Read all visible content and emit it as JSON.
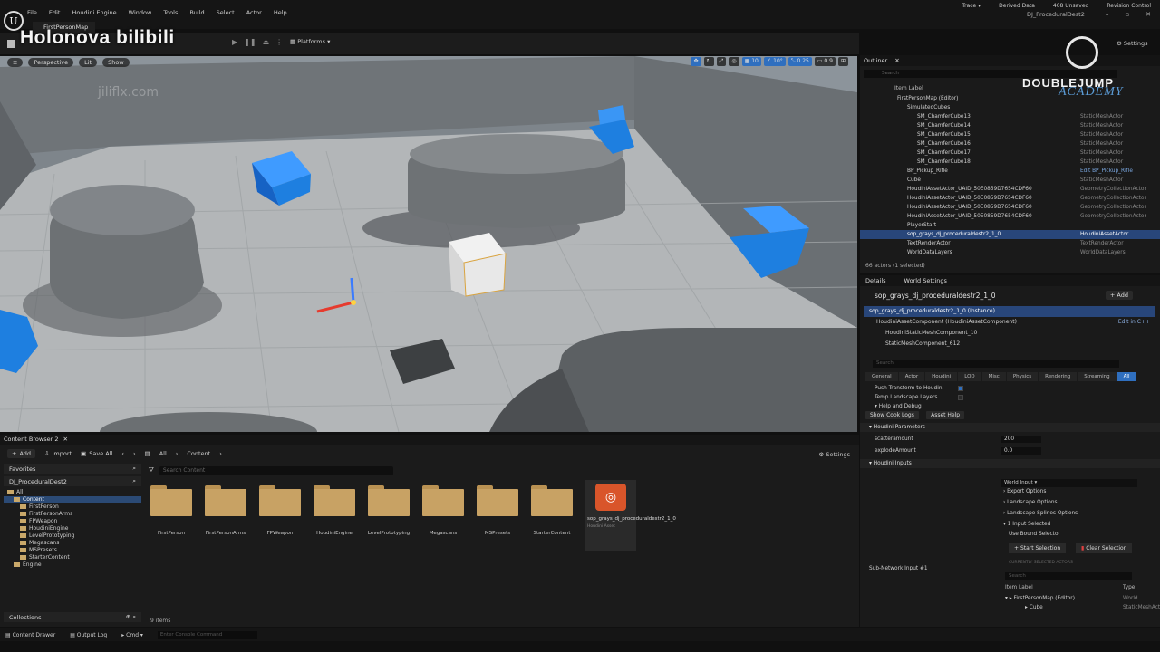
{
  "window": {
    "title": "DJ_ProceduralDest2",
    "menu": [
      "File",
      "Edit",
      "Houdini Engine",
      "Window",
      "Tools",
      "Build",
      "Select",
      "Actor",
      "Help"
    ],
    "map_tab": "FirstPersonMap",
    "controls": [
      "–",
      "▫",
      "✕"
    ]
  },
  "overlays": {
    "watermark": "Holonova bilibili",
    "viewport_watermark": "jiliflx.com",
    "brand_title": "DOUBLEJUMP",
    "brand_subtitle": "ACADEMY"
  },
  "toolbar": {
    "platforms": "Platforms"
  },
  "viewport": {
    "perspective": "Perspective",
    "lit": "Lit",
    "show": "Show",
    "snap_translate": "10",
    "snap_rotate": "10°",
    "snap_scale": "0.25",
    "camera_speed": "0.9"
  },
  "content_browser": {
    "tab": "Content Browser 2",
    "add": "Add",
    "import": "Import",
    "save_all": "Save All",
    "path": [
      "All",
      "Content"
    ],
    "settings": "Settings",
    "favorites": "Favorites",
    "project": "DJ_ProceduralDest2",
    "tree": [
      {
        "label": "All",
        "indent": 0
      },
      {
        "label": "Content",
        "indent": 1,
        "selected": true
      },
      {
        "label": "FirstPerson",
        "indent": 2
      },
      {
        "label": "FirstPersonArms",
        "indent": 2
      },
      {
        "label": "FPWeapon",
        "indent": 2
      },
      {
        "label": "HoudiniEngine",
        "indent": 2
      },
      {
        "label": "LevelPrototyping",
        "indent": 2
      },
      {
        "label": "Megascans",
        "indent": 2
      },
      {
        "label": "MSPresets",
        "indent": 2
      },
      {
        "label": "StarterContent",
        "indent": 2
      },
      {
        "label": "Engine",
        "indent": 1
      }
    ],
    "search_placeholder": "Search Content",
    "folders": [
      "FirstPerson",
      "FirstPersonArms",
      "FPWeapon",
      "HoudiniEngine",
      "LevelPrototyping",
      "Megascans",
      "MSPresets",
      "StarterContent"
    ],
    "hda_asset": {
      "label": "sop_grays_dj_proceduraldestr2_1_0",
      "type": "Houdini Asset"
    },
    "collections": "Collections",
    "item_count": "9 items"
  },
  "statusbar": {
    "content_drawer": "Content Drawer",
    "output_log": "Output Log",
    "cmd": "Cmd",
    "console_placeholder": "Enter Console Command",
    "trace": "Trace",
    "derived_data": "Derived Data",
    "unsaved": "408 Unsaved",
    "revision": "Revision Control"
  },
  "outliner": {
    "tab": "Outliner",
    "settings": "Settings",
    "search_placeholder": "Search",
    "col_label": "Item Label",
    "col_type": "Type",
    "rows": [
      {
        "label": "FirstPersonMap (Editor)",
        "type": "",
        "indent": 3
      },
      {
        "label": "SimulatedCubes",
        "type": "",
        "indent": 4
      },
      {
        "label": "SM_ChamferCube13",
        "type": "StaticMeshActor",
        "indent": 5
      },
      {
        "label": "SM_ChamferCube14",
        "type": "StaticMeshActor",
        "indent": 5
      },
      {
        "label": "SM_ChamferCube15",
        "type": "StaticMeshActor",
        "indent": 5
      },
      {
        "label": "SM_ChamferCube16",
        "type": "StaticMeshActor",
        "indent": 5
      },
      {
        "label": "SM_ChamferCube17",
        "type": "StaticMeshActor",
        "indent": 5
      },
      {
        "label": "SM_ChamferCube18",
        "type": "StaticMeshActor",
        "indent": 5
      },
      {
        "label": "BP_Pickup_Rifle",
        "type": "Edit BP_Pickup_Rifle",
        "indent": 4,
        "link": true
      },
      {
        "label": "Cube",
        "type": "StaticMeshActor",
        "indent": 4
      },
      {
        "label": "HoudiniAssetActor_UAID_50E0859D7654CDF601_2083879015",
        "type": "GeometryCollectionActor",
        "indent": 4
      },
      {
        "label": "HoudiniAssetActor_UAID_50E0859D7654CDF601_2083879015",
        "type": "GeometryCollectionActor",
        "indent": 4
      },
      {
        "label": "HoudiniAssetActor_UAID_50E0859D7654CDF601_2083879015",
        "type": "GeometryCollectionActor",
        "indent": 4
      },
      {
        "label": "HoudiniAssetActor_UAID_50E0859D7654CDF601_2083879015",
        "type": "GeometryCollectionActor",
        "indent": 4
      },
      {
        "label": "PlayerStart",
        "type": "",
        "indent": 4
      },
      {
        "label": "sop_grays_dj_proceduraldestr2_1_0",
        "type": "HoudiniAssetActor",
        "indent": 4,
        "selected": true
      },
      {
        "label": "TextRenderActor",
        "type": "TextRenderActor",
        "indent": 4
      },
      {
        "label": "WorldDataLayers",
        "type": "WorldDataLayers",
        "indent": 4
      }
    ],
    "actor_count": "66 actors (1 selected)"
  },
  "details": {
    "tab": "Details",
    "world_settings": "World Settings",
    "actor_name": "sop_grays_dj_proceduraldestr2_1_0",
    "add": "Add",
    "components": [
      {
        "label": "sop_grays_dj_proceduraldestr2_1_0 (Instance)",
        "selected": true,
        "right": ""
      },
      {
        "label": "HoudiniAssetComponent (HoudiniAssetComponent)",
        "right": "Edit in C++"
      },
      {
        "label": "HoudiniStaticMeshComponent_10",
        "right": ""
      },
      {
        "label": "StaticMeshComponent_612",
        "right": ""
      }
    ],
    "search_placeholder": "Search",
    "filters": [
      "General",
      "Actor",
      "Houdini",
      "LOD",
      "Misc",
      "Physics",
      "Rendering",
      "Streaming",
      "All"
    ],
    "active_filter": "All",
    "push_transform": "Push Transform to Houdini",
    "temp_landscape": "Temp Landscape Layers",
    "help_debug": "Help and Debug",
    "show_cook_logs": "Show Cook Logs",
    "asset_help": "Asset Help",
    "houdini_params": "Houdini Parameters",
    "params": [
      {
        "label": "scatteramount",
        "value": "200"
      },
      {
        "label": "explodeAmount",
        "value": "0.0"
      }
    ],
    "houdini_inputs": "Houdini Inputs",
    "sub_network_input": "Sub-Network Input #1",
    "input_type": "World Input",
    "input_options": [
      "Export Options",
      "Landscape Options",
      "Landscape Splines Options",
      "1 Input Selected"
    ],
    "use_bound_selector": "Use Bound Selector",
    "start_selection": "Start Selection",
    "clear_selection": "Clear Selection",
    "currently_selected": "CURRENTLY SELECTED ACTORS",
    "sel_search_placeholder": "Search",
    "sel_col_label": "Item Label",
    "sel_col_type": "Type",
    "sel_rows": [
      {
        "label": "FirstPersonMap (Editor)",
        "type": "World"
      },
      {
        "label": "Cube",
        "type": "StaticMeshActor"
      }
    ]
  },
  "colors": {
    "selection": "#28467a",
    "accent": "#2f6fbf",
    "cube_blue": "#1e7fe0",
    "folder": "#c8a264",
    "hda_orange": "#d9552a"
  }
}
